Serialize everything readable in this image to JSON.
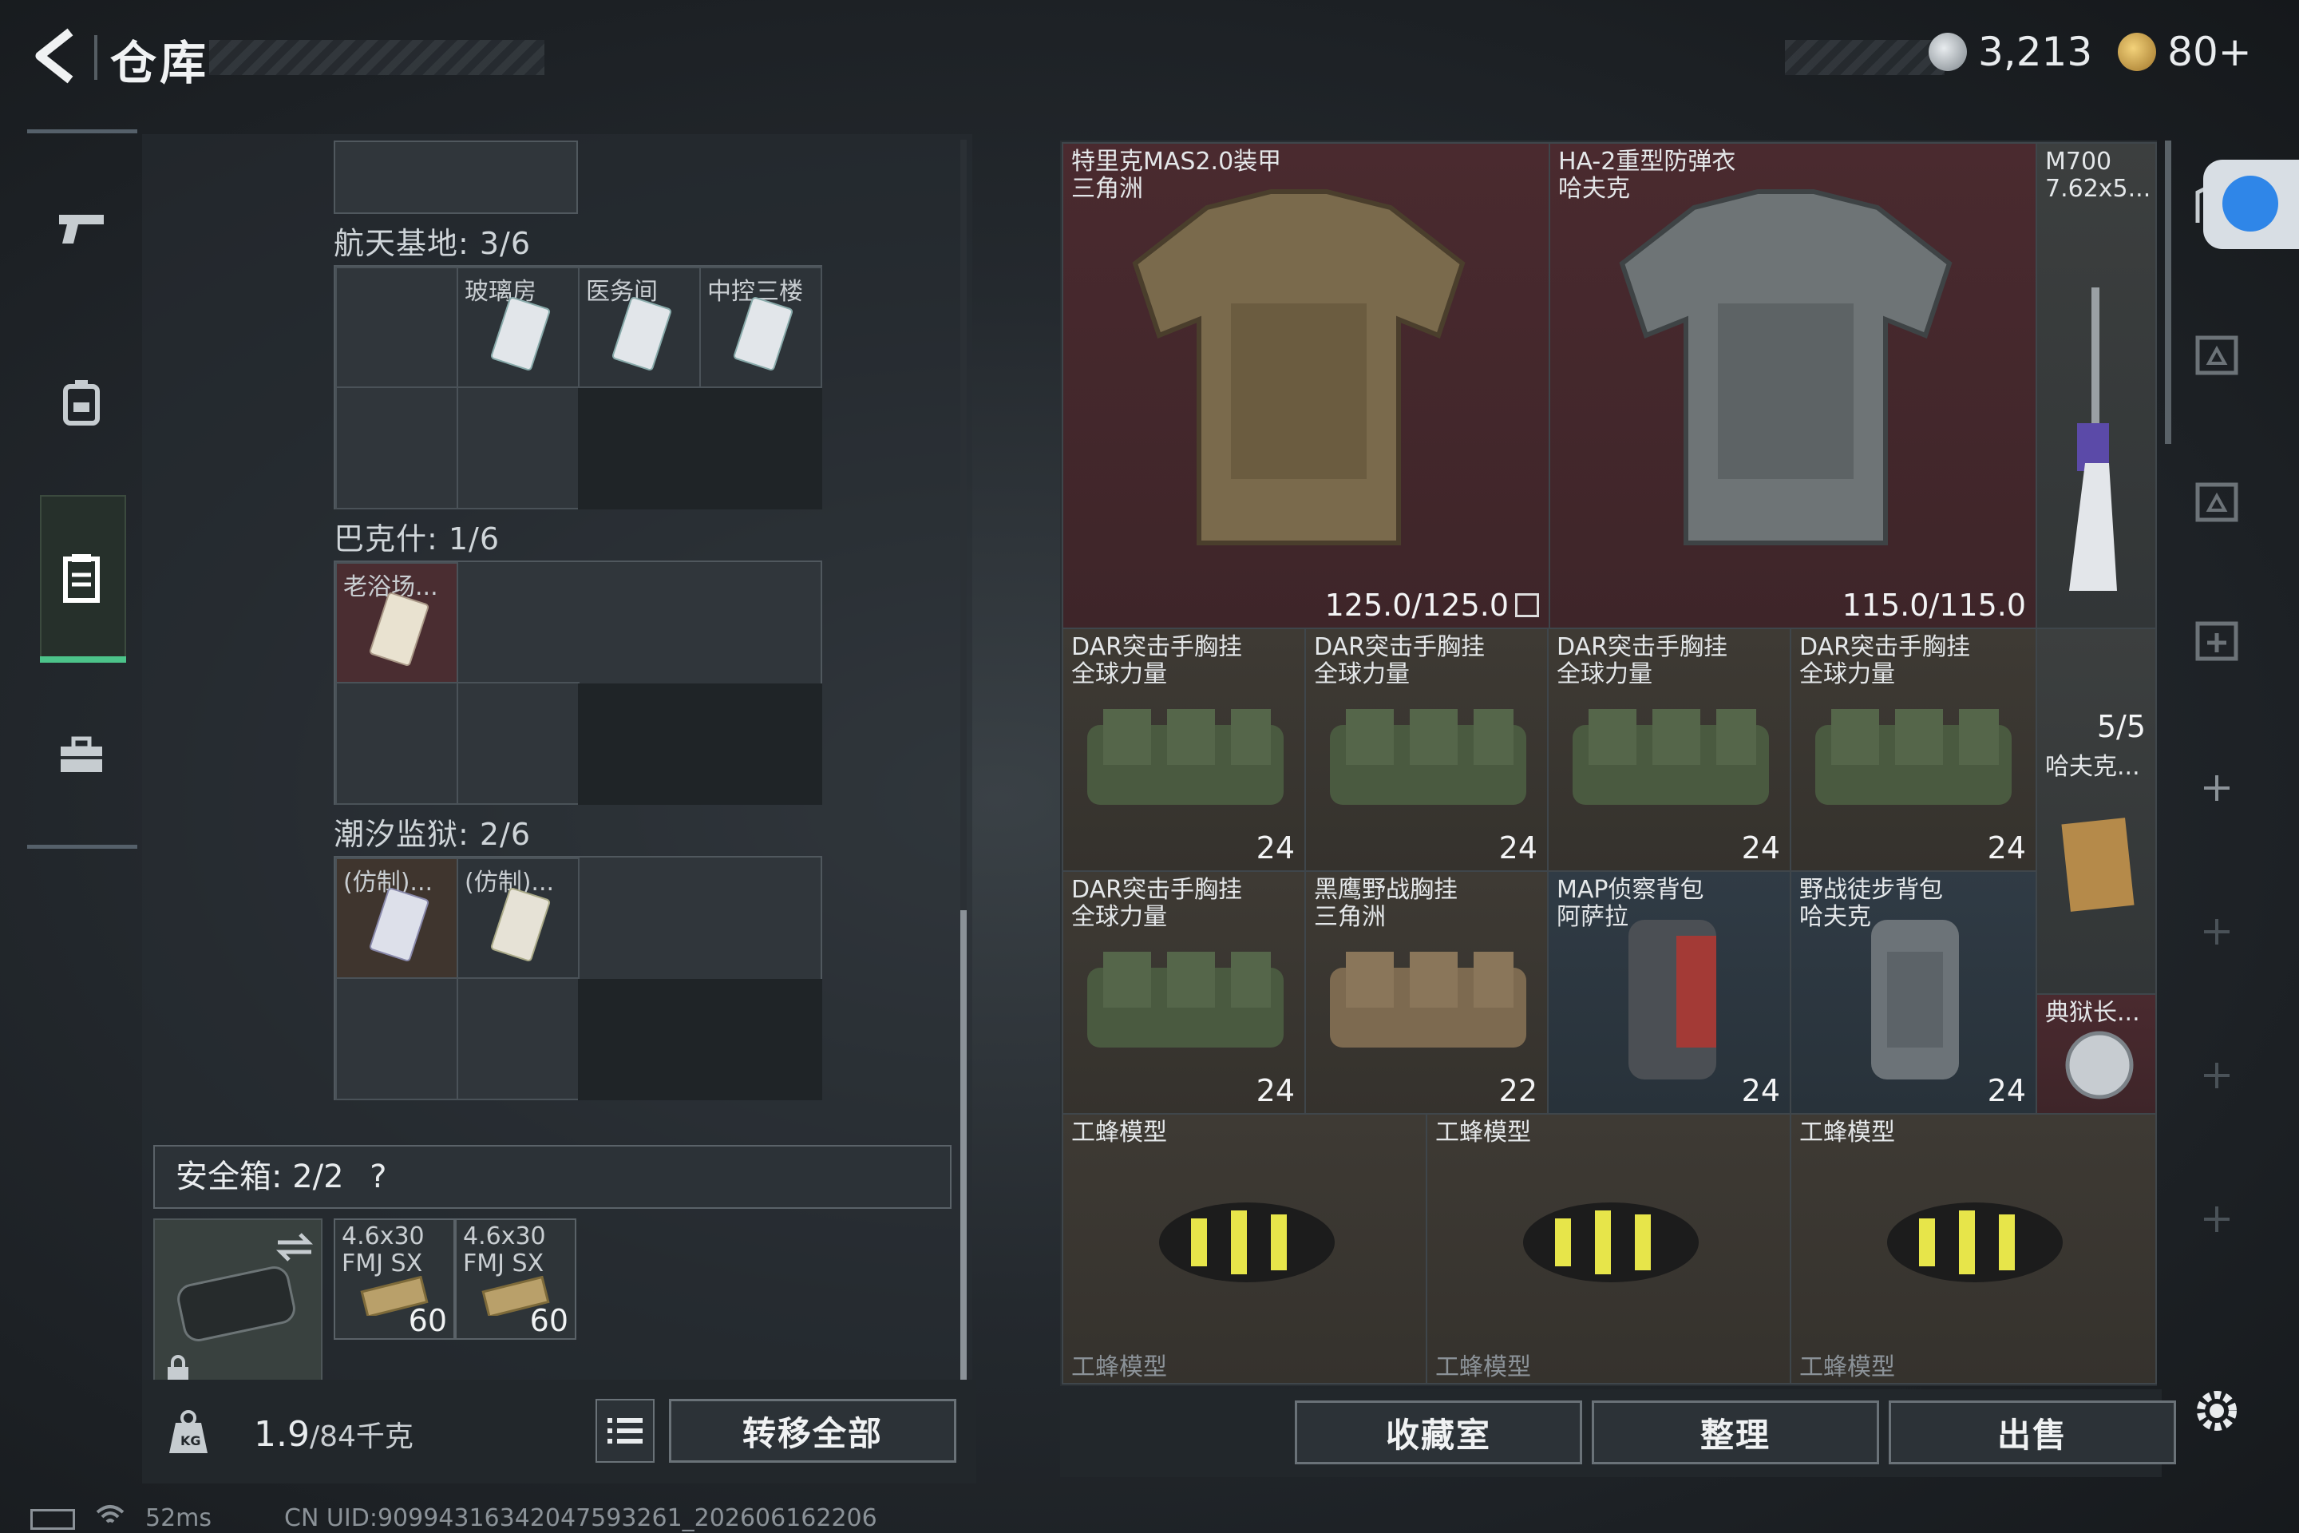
{
  "header": {
    "title": "仓库",
    "currency1": "3,213",
    "currency2": "80+"
  },
  "nav": {
    "items": [
      "weapon-icon",
      "backpack-icon",
      "storage-icon",
      "toolbox-icon"
    ]
  },
  "sections": [
    {
      "label": "航天基地: 3/6",
      "cards": [
        "玻璃房",
        "医务间",
        "中控三楼"
      ]
    },
    {
      "label": "巴克什: 1/6",
      "cards": [
        "老浴场..."
      ]
    },
    {
      "label": "潮汐监狱: 2/6",
      "cards": [
        "(仿制)...",
        "(仿制)..."
      ]
    }
  ],
  "safebox": {
    "label": "安全箱: 2/2",
    "help": "?",
    "ammo": [
      {
        "name": "4.6x30 FMJ SX",
        "count": "60"
      },
      {
        "name": "4.6x30 FMJ SX",
        "count": "60"
      }
    ]
  },
  "weight": {
    "current": "1.9",
    "max": "/84千克"
  },
  "buttons": {
    "transfer_all": "转移全部",
    "collection": "收藏室",
    "organize": "整理",
    "sell": "出售"
  },
  "items": {
    "armor1": {
      "name": "特里克MAS2.0装甲",
      "brand": "三角洲",
      "durability": "125.0/125.0"
    },
    "armor2": {
      "name": "HA-2重型防弹衣",
      "brand": "哈夫克",
      "durability": "115.0/115.0"
    },
    "rifle": {
      "name": "M700",
      "brand": "7.62x5..."
    },
    "vest1": {
      "name": "DAR突击手胸挂",
      "brand": "全球力量",
      "cap": "24"
    },
    "vest2": {
      "name": "DAR突击手胸挂",
      "brand": "全球力量",
      "cap": "24"
    },
    "vest3": {
      "name": "DAR突击手胸挂",
      "brand": "全球力量",
      "cap": "24"
    },
    "vest4": {
      "name": "DAR突击手胸挂",
      "brand": "全球力量",
      "cap": "24"
    },
    "vest5": {
      "name": "DAR突击手胸挂",
      "brand": "全球力量",
      "cap": "24"
    },
    "vest6": {
      "name": "黑鹰野战胸挂",
      "brand": "三角洲",
      "cap": "22"
    },
    "bag1": {
      "name": "MAP侦察背包",
      "brand": "阿萨拉",
      "cap": "24"
    },
    "bag2": {
      "name": "野战徒步背包",
      "brand": "哈夫克",
      "cap": "24"
    },
    "misc1": {
      "name": "哈夫克...",
      "count": "5/5"
    },
    "misc2": {
      "name": "典狱长..."
    },
    "bee1": {
      "name": "工蜂模型"
    },
    "bee2": {
      "name": "工蜂模型"
    },
    "bee3": {
      "name": "工蜂模型"
    },
    "bee4": {
      "name": "工蜂模型"
    },
    "bee5": {
      "name": "工蜂模型"
    },
    "bee6": {
      "name": "工蜂模型"
    }
  },
  "footer": {
    "ping": "52ms",
    "uid": "CN UID:90994316342047593261_202606162206"
  },
  "colors": {
    "accent": "#4cc38a",
    "rare_red": "#4a2a2f",
    "rare_blue": "#303b45"
  }
}
